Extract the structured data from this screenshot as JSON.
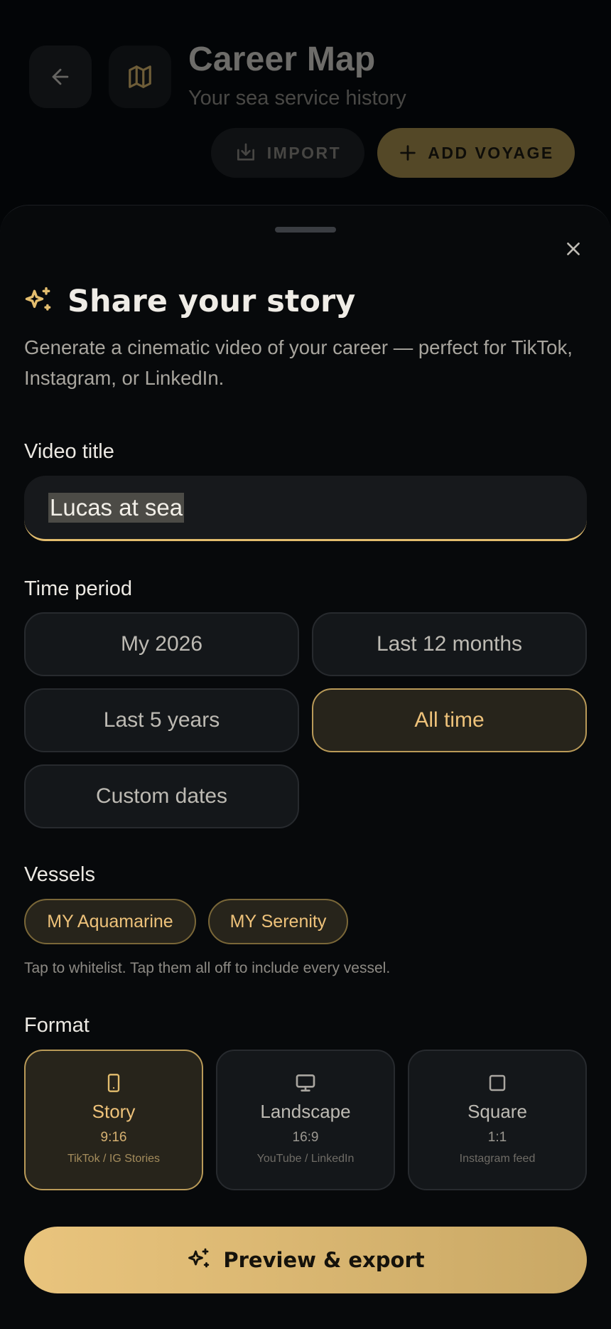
{
  "header": {
    "title": "Career Map",
    "subtitle": "Your sea service history",
    "import_label": "IMPORT",
    "add_voyage_label": "ADD VOYAGE"
  },
  "sheet": {
    "title": "Share your story",
    "description": "Generate a cinematic video of your career — perfect for TikTok, Instagram, or LinkedIn.",
    "video_title": {
      "label": "Video title",
      "value": "Lucas at sea"
    },
    "time_period": {
      "label": "Time period",
      "options": [
        "My 2026",
        "Last 12 months",
        "Last 5 years",
        "All time",
        "Custom dates"
      ],
      "selected": "All time"
    },
    "vessels": {
      "label": "Vessels",
      "items": [
        "MY Aquamarine",
        "MY Serenity"
      ],
      "hint": "Tap to whitelist. Tap them all off to include every vessel."
    },
    "format": {
      "label": "Format",
      "options": [
        {
          "name": "Story",
          "ratio": "9:16",
          "use": "TikTok / IG Stories",
          "icon": "phone-icon"
        },
        {
          "name": "Landscape",
          "ratio": "16:9",
          "use": "YouTube / LinkedIn",
          "icon": "monitor-icon"
        },
        {
          "name": "Square",
          "ratio": "1:1",
          "use": "Instagram feed",
          "icon": "square-icon"
        }
      ],
      "selected": "Story"
    },
    "cta_label": "Preview & export"
  },
  "colors": {
    "accent": "#E9C47D",
    "sheet_bg": "#07090B",
    "chip_bg": "#14171A"
  }
}
